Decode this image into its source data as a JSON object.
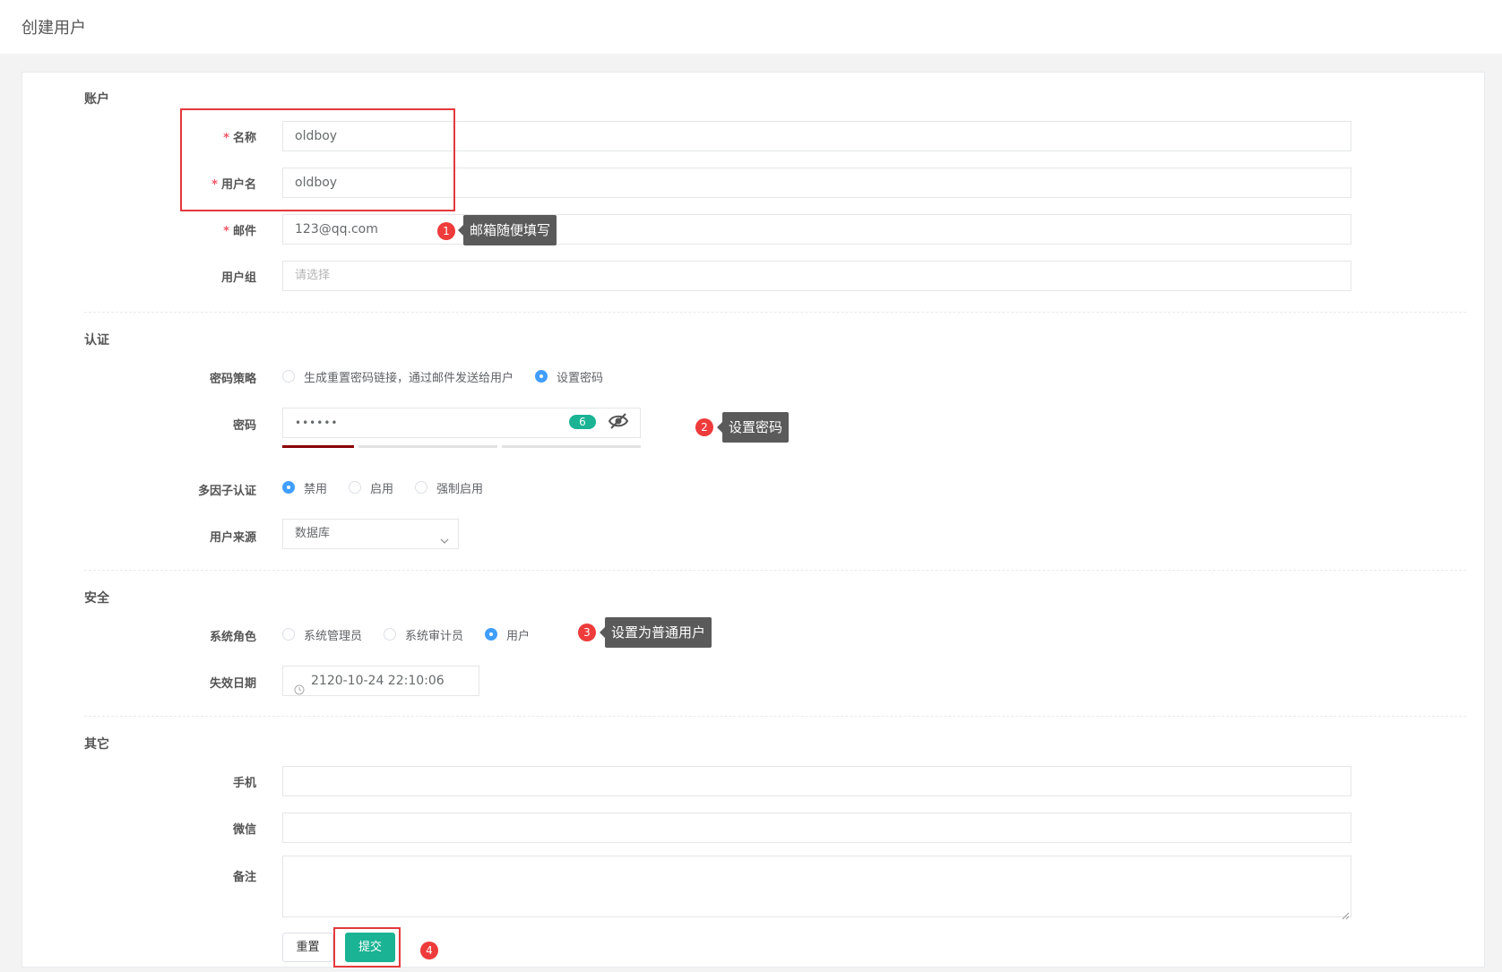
{
  "page": {
    "title": "创建用户"
  },
  "sections": {
    "account": "账户",
    "auth": "认证",
    "security": "安全",
    "other": "其它"
  },
  "account": {
    "name_label": "名称",
    "name_value": "oldboy",
    "username_label": "用户名",
    "username_value": "oldboy",
    "email_label": "邮件",
    "email_value": "123@qq.com",
    "group_label": "用户组",
    "group_placeholder": "请选择",
    "required_mark": "*"
  },
  "auth": {
    "policy_label": "密码策略",
    "policy_options": [
      "生成重置密码链接，通过邮件发送给用户",
      "设置密码"
    ],
    "policy_selected": 1,
    "password_label": "密码",
    "password_masked": "••••••",
    "password_length_badge": "6",
    "password_strength": {
      "filled_segments": 1,
      "total_segments": 5
    },
    "mfa_label": "多因子认证",
    "mfa_options": [
      "禁用",
      "启用",
      "强制启用"
    ],
    "mfa_selected": 0,
    "source_label": "用户来源",
    "source_value": "数据库"
  },
  "security": {
    "role_label": "系统角色",
    "role_options": [
      "系统管理员",
      "系统审计员",
      "用户"
    ],
    "role_selected": 2,
    "expire_label": "失效日期",
    "expire_value": "2120-10-24 22:10:06"
  },
  "other": {
    "phone_label": "手机",
    "wechat_label": "微信",
    "comment_label": "备注"
  },
  "buttons": {
    "reset": "重置",
    "submit": "提交"
  },
  "annotations": [
    {
      "num": "1",
      "text": "邮箱随便填写"
    },
    {
      "num": "2",
      "text": "设置密码"
    },
    {
      "num": "3",
      "text": "设置为普通用户"
    },
    {
      "num": "4",
      "text": ""
    }
  ],
  "colors": {
    "accent_green": "#1ab394",
    "radio_blue": "#409eff",
    "required_red": "#ed5565",
    "highlight_red": "#e4393c",
    "marker_red": "#ee3b3b",
    "tooltip_gray": "#5a5a5a"
  },
  "icons": {
    "eye": "eye-slash-icon",
    "select": "chevron-down-icon",
    "date": "clock-icon"
  }
}
